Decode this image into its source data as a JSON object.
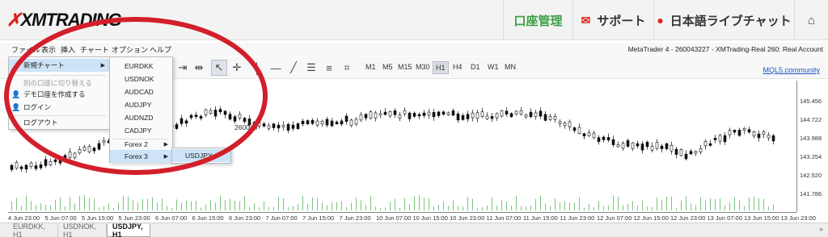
{
  "topbar": {
    "logo": "XMTRADING",
    "account": "口座管理",
    "support": "サポート",
    "chat": "日本語ライブチャット",
    "home_icon": "home-icon"
  },
  "menubar": {
    "items": [
      "ファイル",
      "表示",
      "挿入",
      "チャート",
      "オプション",
      "ヘルプ"
    ],
    "account_info": "MetaTrader 4 - 260043227 - XMTrading-Real 260: Real Account"
  },
  "toolbar": {
    "timeframes": [
      "M1",
      "M5",
      "M15",
      "M30",
      "H1",
      "H4",
      "D1",
      "W1",
      "MN"
    ],
    "active_timeframe": "H1",
    "mql_link": "MQL5.community"
  },
  "file_menu": {
    "new_chart": "新規チャート",
    "switch_account": "別の口座に切り替える",
    "create_demo": "デモ口座を作成する",
    "login": "ログイン",
    "logout": "ログアウト"
  },
  "symbol_menu": {
    "symbols": [
      "EURDKK",
      "USDNOK",
      "AUDCAD",
      "AUDJPY",
      "AUDNZD",
      "CADJPY"
    ],
    "forex2": "Forex 2",
    "forex3": "Forex 3"
  },
  "forex3_menu": {
    "items": [
      "USDJPY"
    ]
  },
  "chart": {
    "watermark": "260043",
    "price_labels": [
      "145.456",
      "144.722",
      "143.988",
      "143.254",
      "142.520",
      "141.786"
    ],
    "time_labels": [
      "4 Jun 23:00",
      "5 Jun 07:00",
      "5 Jun 15:00",
      "5 Jun 23:00",
      "6 Jun 07:00",
      "6 Jun 15:00",
      "6 Jun 23:00",
      "7 Jun 07:00",
      "7 Jun 15:00",
      "7 Jun 23:00",
      "10 Jun 07:00",
      "10 Jun 15:00",
      "10 Jun 23:00",
      "11 Jun 07:00",
      "11 Jun 15:00",
      "11 Jun 23:00",
      "12 Jun 07:00",
      "12 Jun 15:00",
      "12 Jun 23:00",
      "13 Jun 07:00",
      "13 Jun 15:00",
      "13 Jun 23:00"
    ]
  },
  "tabs": [
    "EURDKK, H1",
    "USDNOK, H1",
    "USDJPY, H1"
  ],
  "active_tab": "USDJPY, H1"
}
